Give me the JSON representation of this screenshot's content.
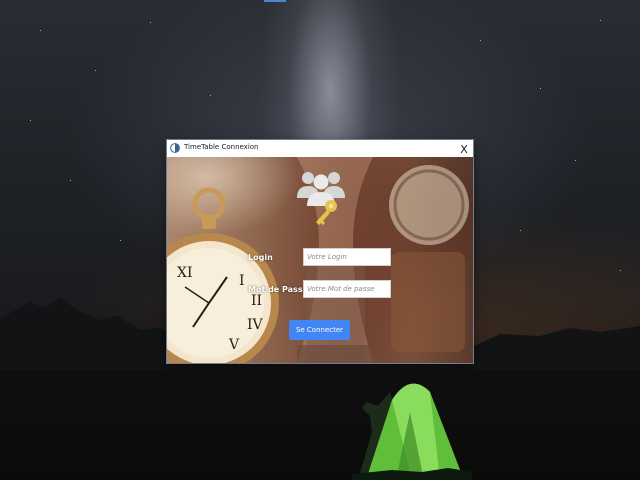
{
  "window": {
    "title": "TimeTable Connexion",
    "close_symbol": "X",
    "app_icon": "timetable-app-icon"
  },
  "form": {
    "header_icon": "users-key-icon",
    "login_label": "Login",
    "login_placeholder": "Votre Login",
    "login_value": "",
    "password_label": "Mot de Passe",
    "password_placeholder": "Votre.Mot de passe",
    "password_value": "",
    "submit_label": "Se Connecter"
  },
  "colors": {
    "accent": "#4285f4",
    "label_text": "#ffffff",
    "key_gold": "#e8c24a",
    "tent_green": "#7ed957"
  }
}
